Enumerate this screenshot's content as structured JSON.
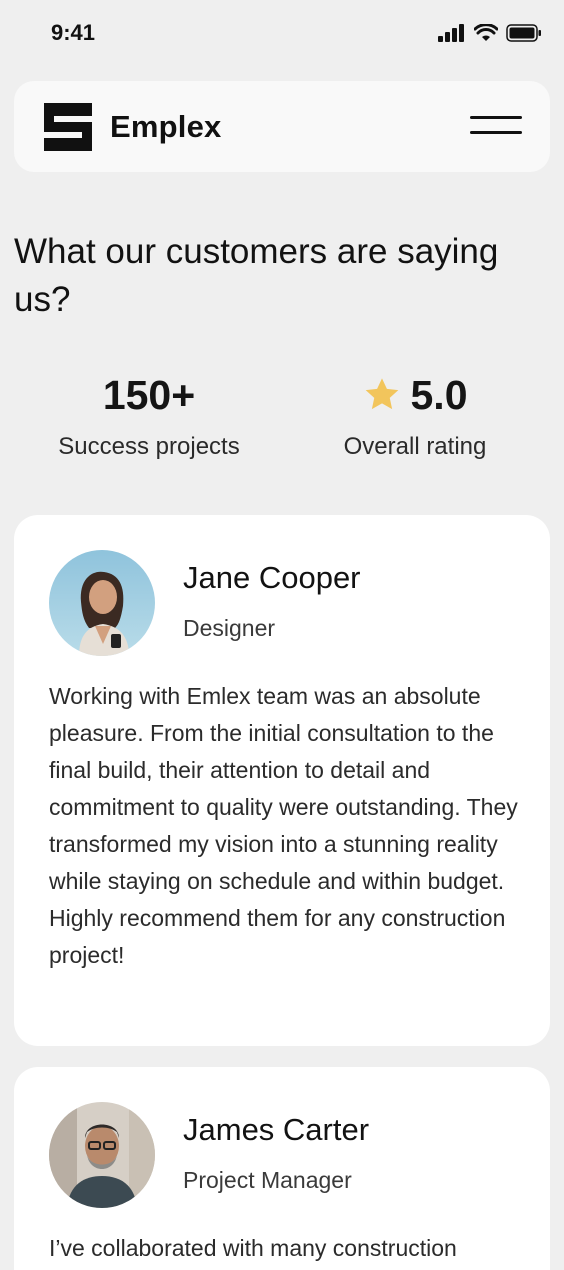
{
  "status_bar": {
    "time": "9:41",
    "icons": [
      "signal-icon",
      "wifi-icon",
      "battery-icon"
    ]
  },
  "header": {
    "brand": "Emplex",
    "logo_icon": "emplex-logo-icon",
    "menu_icon": "hamburger-menu-icon"
  },
  "section": {
    "title": "What our customers are saying us?"
  },
  "stats": [
    {
      "value": "150+",
      "label": "Success projects"
    },
    {
      "value": "5.0",
      "label": "Overall rating",
      "icon": "star-icon",
      "icon_color": "#f2c55c"
    }
  ],
  "testimonials": [
    {
      "name": "Jane Cooper",
      "role": "Designer",
      "quote": "Working with Emlex team was an absolute pleasure. From the initial consultation to the final build, their attention to detail and commitment to quality were outstanding. They transformed my vision into a stunning reality while staying on schedule and within budget. Highly recommend them for any construction project!"
    },
    {
      "name": "James Carter",
      "role": "Project Manager",
      "quote": "I’ve collaborated with many construction"
    }
  ],
  "colors": {
    "background": "#efefef",
    "card": "#ffffff",
    "header": "#f9f9f9",
    "text": "#121212",
    "star": "#f2c55c"
  }
}
